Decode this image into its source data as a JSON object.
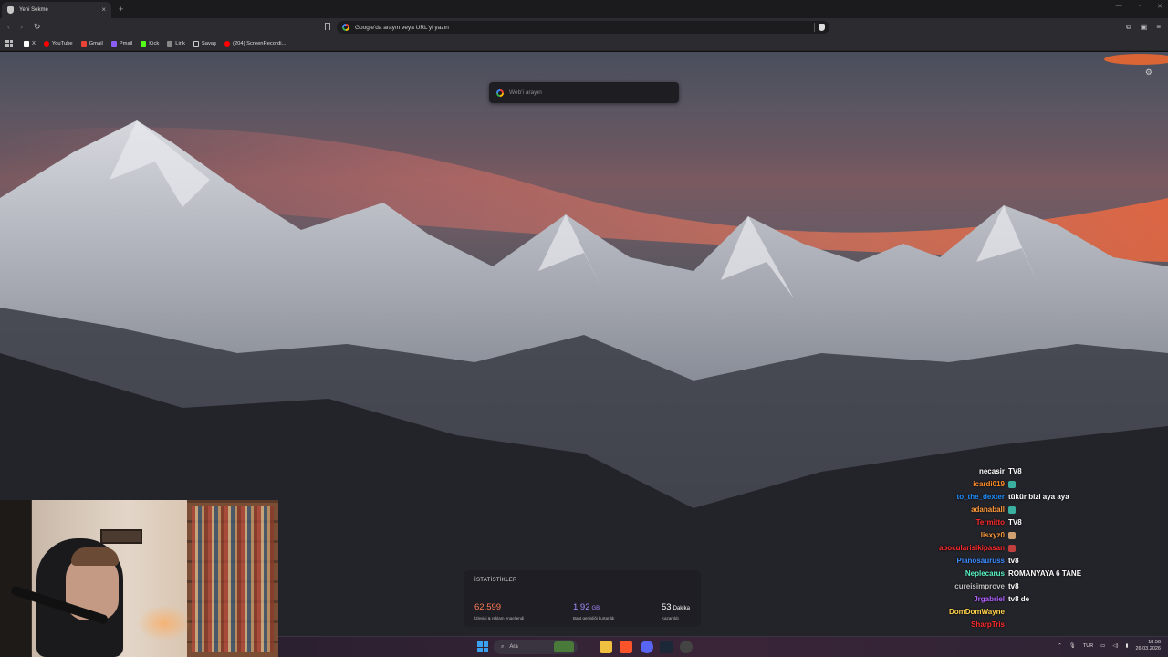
{
  "browser": {
    "tab_title": "Yeni Sekme",
    "tab_close": "×",
    "new_tab": "+",
    "omnibox_placeholder": "Google'da arayın veya URL'yi yazın",
    "bookmarks": [
      {
        "label": "X",
        "icon": "x-icon",
        "color": "#ffffff"
      },
      {
        "label": "YouTube",
        "icon": "youtube-icon",
        "color": "#ff0000"
      },
      {
        "label": "Gmail",
        "icon": "gmail-icon",
        "color": "#ea4335"
      },
      {
        "label": "Pmail",
        "icon": "mail-icon",
        "color": "#8b5cf6"
      },
      {
        "label": "Kick",
        "icon": "kick-icon",
        "color": "#53fc18"
      },
      {
        "label": "Link",
        "icon": "link-icon",
        "color": "#888888"
      },
      {
        "label": "Savaş",
        "icon": "folder-icon",
        "color": "#cccccc"
      },
      {
        "label": "(204) ScreenRecordi...",
        "icon": "youtube-icon",
        "color": "#ff0000"
      }
    ]
  },
  "newtab": {
    "search_placeholder": "Web'i arayın",
    "stats": {
      "title": "İSTATİSTİKLER",
      "ads_blocked_value": "62.599",
      "ads_blocked_label": "İzleyici & reklam engellendi",
      "bandwidth_value": "1,92",
      "bandwidth_unit": "GB",
      "bandwidth_label": "Bant genişliği kurtarıldı",
      "time_value": "53",
      "time_unit": "Dakika",
      "time_label": "Kazanıldı"
    }
  },
  "chat": [
    {
      "user": "necasir",
      "color": "#ffffff",
      "msg": "TV8"
    },
    {
      "user": "icardi019",
      "color": "#ff8c2a",
      "msg": ""
    },
    {
      "user": "to_the_dexter",
      "color": "#1e90ff",
      "msg": "tükür bizi aya aya"
    },
    {
      "user": "adanaball",
      "color": "#ff9a3a",
      "msg": ""
    },
    {
      "user": "Termitto",
      "color": "#ff2a2a",
      "msg": "TV8"
    },
    {
      "user": "lisxyz0",
      "color": "#ff9a3a",
      "msg": ""
    },
    {
      "user": "apocularisikipasan",
      "color": "#ff2a2a",
      "msg": ""
    },
    {
      "user": "Pianosauruss",
      "color": "#3a8cff",
      "msg": "tv8"
    },
    {
      "user": "Neplecarus",
      "color": "#5af0c0",
      "msg": "ROMANYAYA 6 TANE"
    },
    {
      "user": "cureisimprove",
      "color": "#bfbfbf",
      "msg": "tv8"
    },
    {
      "user": "Jrgabriel",
      "color": "#b060ff",
      "msg": "tv8 de"
    },
    {
      "user": "DomDomWayne",
      "color": "#ffd24a",
      "msg": ""
    },
    {
      "user": "SharpTris",
      "color": "#ff2a2a",
      "msg": ""
    }
  ],
  "taskbar": {
    "search_label": "Ara",
    "lang": "TUR",
    "time": "18:56",
    "date": "26.03.2026"
  }
}
